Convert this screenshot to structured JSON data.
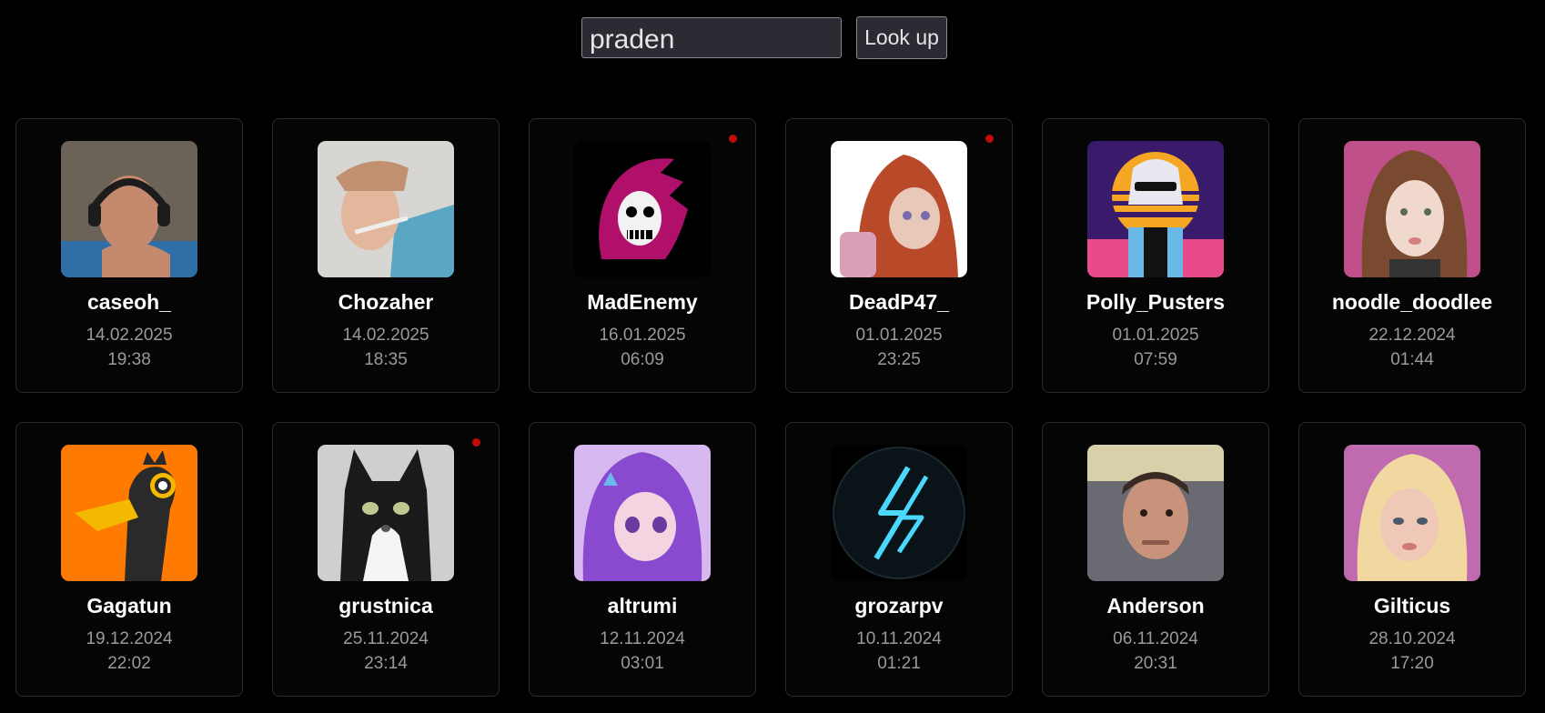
{
  "search": {
    "value": "praden",
    "button_label": "Look up"
  },
  "cards": [
    {
      "name": "caseoh_",
      "date": "14.02.2025",
      "time": "19:38",
      "live": false,
      "avatar": "man-with-headphones-photo",
      "palette": [
        "#6b6258",
        "#c58a6e",
        "#2e6fa8"
      ]
    },
    {
      "name": "Chozaher",
      "date": "14.02.2025",
      "time": "18:35",
      "live": false,
      "avatar": "child-with-thermometer-photo",
      "palette": [
        "#d8d6d2",
        "#e3b79c",
        "#5aa7c4"
      ]
    },
    {
      "name": "MadEnemy",
      "date": "16.01.2025",
      "time": "06:09",
      "live": true,
      "avatar": "hooded-skull-logo",
      "palette": [
        "#000000",
        "#b0106a",
        "#f2f2f2"
      ]
    },
    {
      "name": "DeadP47_",
      "date": "01.01.2025",
      "time": "23:25",
      "live": true,
      "avatar": "anime-redhead-girl",
      "palette": [
        "#ffffff",
        "#b84a2a",
        "#e8c8b8"
      ]
    },
    {
      "name": "Polly_Pusters",
      "date": "01.01.2025",
      "time": "07:59",
      "live": false,
      "avatar": "synthwave-girl-pixel-art",
      "palette": [
        "#3a1a6a",
        "#f5a623",
        "#e84a8a"
      ]
    },
    {
      "name": "noodle_doodlee",
      "date": "22.12.2024",
      "time": "01:44",
      "live": false,
      "avatar": "cosplay-girl-photo",
      "palette": [
        "#c0508a",
        "#7a4a30",
        "#f0d8cc"
      ]
    },
    {
      "name": "Gagatun",
      "date": "19.12.2024",
      "time": "22:02",
      "live": false,
      "avatar": "black-duck-cartoon",
      "palette": [
        "#ff7a00",
        "#2a2a2a",
        "#f5b800"
      ]
    },
    {
      "name": "grustnica",
      "date": "25.11.2024",
      "time": "23:14",
      "live": true,
      "avatar": "black-white-cat-photo",
      "palette": [
        "#cfcfcf",
        "#1a1a1a",
        "#f5f5f5"
      ]
    },
    {
      "name": "altrumi",
      "date": "12.11.2024",
      "time": "03:01",
      "live": false,
      "avatar": "anime-purple-hair-girl",
      "palette": [
        "#8a4ad0",
        "#d8b8f0",
        "#f4d4e0"
      ]
    },
    {
      "name": "grozarpv",
      "date": "10.11.2024",
      "time": "01:21",
      "live": false,
      "avatar": "blue-lightning-logo",
      "palette": [
        "#000000",
        "#0a1418",
        "#4ad8ff"
      ]
    },
    {
      "name": "Anderson",
      "date": "06.11.2024",
      "time": "20:31",
      "live": false,
      "avatar": "man-lying-on-pillow-photo",
      "palette": [
        "#6a6a72",
        "#c8937a",
        "#3a2a24"
      ]
    },
    {
      "name": "Gilticus",
      "date": "28.10.2024",
      "time": "17:20",
      "live": false,
      "avatar": "blonde-girl-photo",
      "palette": [
        "#c06ab0",
        "#f0d8a0",
        "#f0c8b8"
      ]
    }
  ]
}
